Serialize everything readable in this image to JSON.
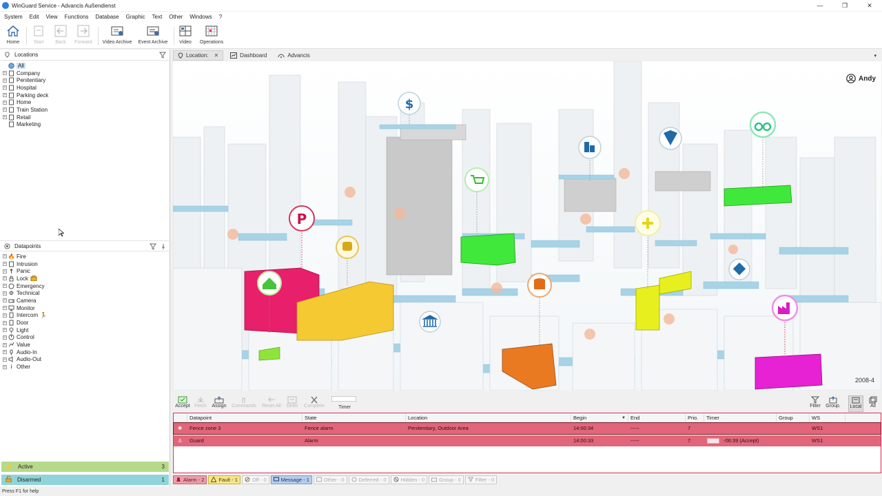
{
  "window": {
    "title": "WinGuard Service - Advancis Außendienst",
    "controls": [
      "—",
      "❐",
      "✕"
    ]
  },
  "menu": [
    "System",
    "Edit",
    "View",
    "Functions",
    "Database",
    "Graphic",
    "Text",
    "Other",
    "Windows",
    "?"
  ],
  "toolbar": {
    "home": "Home",
    "start": "Start",
    "back": "Back",
    "forward": "Forward",
    "video_archive": "Video Archive",
    "event_archive": "Event Archive",
    "video": "Video",
    "operations": "Operations"
  },
  "locations": {
    "title": "Locations",
    "items": [
      {
        "label": "All",
        "selected": true
      },
      {
        "label": "Company"
      },
      {
        "label": "Penitentiary"
      },
      {
        "label": "Hospital"
      },
      {
        "label": "Parking deck"
      },
      {
        "label": "Home"
      },
      {
        "label": "Train Station"
      },
      {
        "label": "Retail"
      },
      {
        "label": "Marketing"
      }
    ]
  },
  "datapoints": {
    "title": "Datapoints",
    "items": [
      {
        "label": "Fire"
      },
      {
        "label": "Intrusion"
      },
      {
        "label": "Panic"
      },
      {
        "label": "Lock"
      },
      {
        "label": "Emergency"
      },
      {
        "label": "Technical"
      },
      {
        "label": "Camera"
      },
      {
        "label": "Monitor"
      },
      {
        "label": "Intercom"
      },
      {
        "label": "Door"
      },
      {
        "label": "Light"
      },
      {
        "label": "Control"
      },
      {
        "label": "Value"
      },
      {
        "label": "Audio-In"
      },
      {
        "label": "Audio-Out"
      },
      {
        "label": "Other"
      }
    ]
  },
  "status": {
    "active": {
      "label": "Active",
      "count": "3",
      "color": "#b7d98b"
    },
    "disarmed": {
      "label": "Disarmed",
      "count": "1",
      "color": "#8fd4d8"
    }
  },
  "tabs": {
    "location": "Location:",
    "dashboard": "Dashboard",
    "advancis": "Advancis"
  },
  "map": {
    "user": "Andy",
    "zoom_label": "2008-4",
    "poi_icons": [
      "dollar-icon",
      "parking-icon",
      "train-icon",
      "home-icon",
      "cart-icon",
      "buildings-icon",
      "shield-icon",
      "binoculars-icon",
      "plus-icon",
      "database-icon",
      "bank-icon",
      "cube-icon",
      "factory-icon"
    ],
    "colors": {
      "pink": "#e81f6a",
      "yellow": "#f5c932",
      "green": "#3fe83a",
      "orange": "#ea7a22",
      "magenta": "#e721d4",
      "lime": "#e7ef1f",
      "sky": "#a8d3e6"
    }
  },
  "alarm_toolbar": {
    "accept": "Accept",
    "fetch": "Fetch",
    "assign": "Assign",
    "commands": "Commands",
    "reset_all": "Reset All",
    "defer": "Defer",
    "complete": "Complete",
    "timer": "Timer",
    "filter": "Filter",
    "group": "Group.",
    "local": "Local",
    "all": "All"
  },
  "grid": {
    "headers": [
      "Datapoint",
      "State",
      "Location",
      "Begin",
      "End",
      "Prio.",
      "Timer",
      "Group",
      "WS"
    ],
    "rows": [
      {
        "datapoint": "Fence zone 3",
        "state": "Fence alarm",
        "location": "Penitentiary, Outdoor Area",
        "begin": "14:00:34",
        "end": "-----",
        "prio": "7",
        "timer": "",
        "group": "",
        "ws": "WS1"
      },
      {
        "datapoint": "Guard",
        "state": "Alarm",
        "location": "",
        "begin": "14:00:33",
        "end": "-----",
        "prio": "7",
        "timer": "-06:39 (Accept)",
        "group": "",
        "ws": "WS1"
      }
    ]
  },
  "filters": [
    {
      "label": "Alarm - 2",
      "bg": "#e8a0a9",
      "fg": "#6a0f1f",
      "icon": "alarm-bell-icon"
    },
    {
      "label": "Fault - 1",
      "bg": "#f6e58a",
      "fg": "#4a3d00",
      "icon": "fault-icon"
    },
    {
      "label": "Off - 0",
      "bg": "#f6f6f6",
      "fg": "#aaaaaa",
      "icon": "off-icon"
    },
    {
      "label": "Message - 1",
      "bg": "#b7cdea",
      "fg": "#1b3a6b",
      "icon": "message-icon"
    },
    {
      "label": "Other - 0",
      "bg": "#f6f6f6",
      "fg": "#aaaaaa",
      "icon": "other-icon"
    },
    {
      "label": "Deferred - 0",
      "bg": "#f6f6f6",
      "fg": "#aaaaaa",
      "icon": "deferred-icon"
    },
    {
      "label": "Hidden - 0",
      "bg": "#f6f6f6",
      "fg": "#aaaaaa",
      "icon": "hidden-icon"
    },
    {
      "label": "Group - 0",
      "bg": "#f6f6f6",
      "fg": "#aaaaaa",
      "icon": "group-icon"
    },
    {
      "label": "Filter - 0",
      "bg": "#f6f6f6",
      "fg": "#aaaaaa",
      "icon": "filter-icon"
    }
  ],
  "statusbar": "Press F1 for help"
}
